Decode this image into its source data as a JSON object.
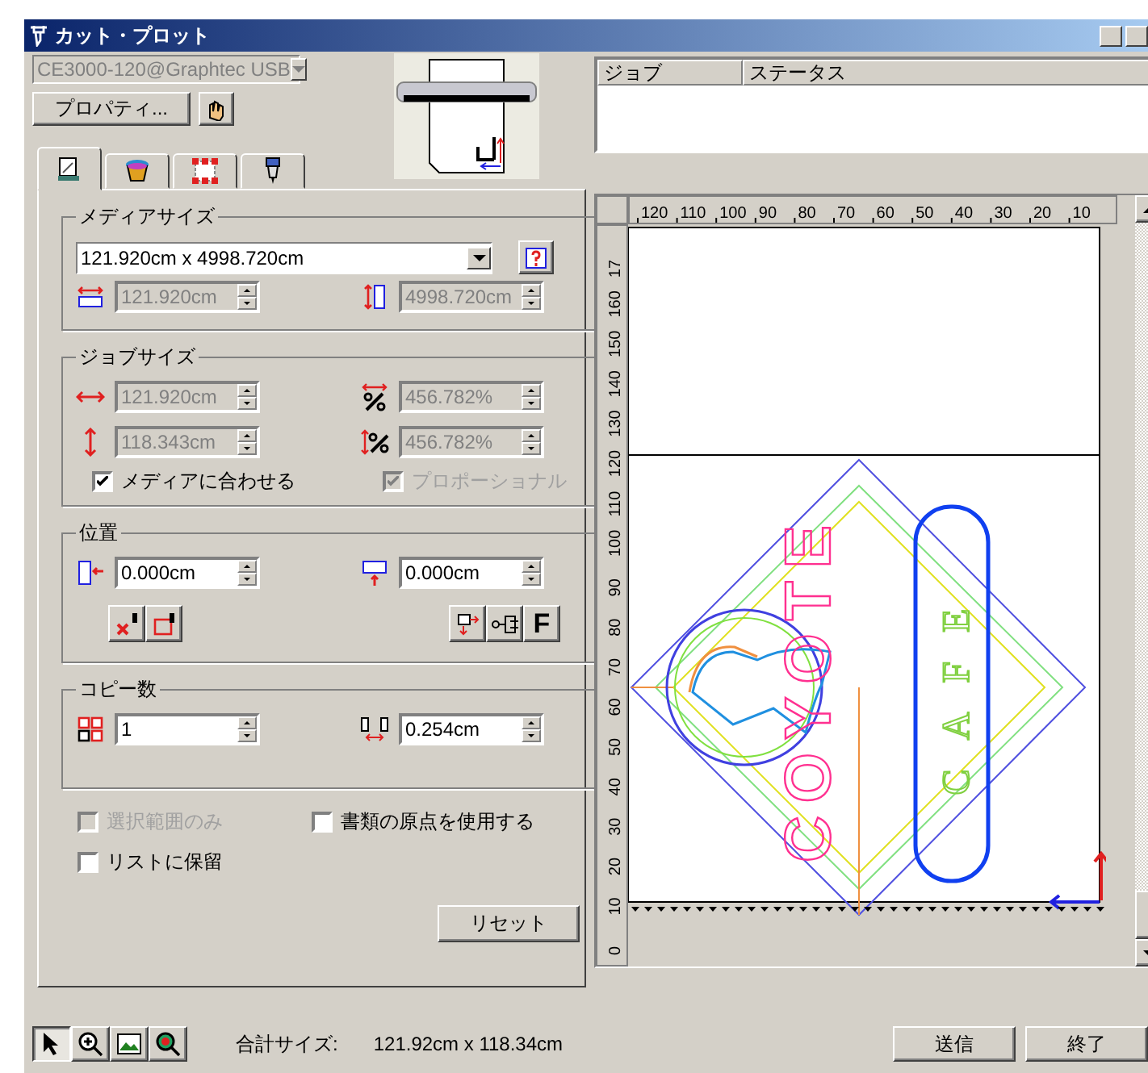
{
  "window": {
    "title": "カット・プロット"
  },
  "printer": {
    "value": "CE3000-120@Graphtec USB",
    "disabled": true
  },
  "properties_button": "プロパティ...",
  "job_list": {
    "columns": [
      "ジョブ",
      "ステータス"
    ]
  },
  "tabs": [
    {
      "selected": true
    },
    {
      "selected": false
    },
    {
      "selected": false
    },
    {
      "selected": false
    }
  ],
  "media_size": {
    "title": "メディアサイズ",
    "value": "121.920cm x 4998.720cm",
    "width": {
      "value": "121.920cm",
      "disabled": true
    },
    "length": {
      "value": "4998.720cm",
      "disabled": true
    }
  },
  "job_size": {
    "title": "ジョブサイズ",
    "width": {
      "value": "121.920cm",
      "disabled": true
    },
    "width_percent": {
      "value": "456.782%",
      "disabled": true
    },
    "height": {
      "value": "118.343cm",
      "disabled": true
    },
    "height_percent": {
      "value": "456.782%",
      "disabled": true
    },
    "checks": [
      {
        "label": "メディアに合わせる",
        "checked": true,
        "disabled": false
      },
      {
        "label": "プロポーショナル",
        "checked": true,
        "disabled": true
      }
    ]
  },
  "position": {
    "title": "位置",
    "x": {
      "value": "0.000cm",
      "disabled": false
    },
    "y": {
      "value": "0.000cm",
      "disabled": false
    },
    "f_button": "F"
  },
  "copies": {
    "title": "コピー数",
    "count": {
      "value": "1",
      "disabled": false
    },
    "spacing": {
      "value": "0.254cm",
      "disabled": false
    }
  },
  "options": [
    {
      "label": "選択範囲のみ",
      "checked": false,
      "disabled": true
    },
    {
      "label": "書類の原点を使用する",
      "checked": false,
      "disabled": false
    },
    {
      "label": "リストに保留",
      "checked": false,
      "disabled": false
    }
  ],
  "reset_button": "リセット",
  "preview": {
    "x_ruler": [
      "120",
      "110",
      "100",
      "90",
      "80",
      "70",
      "60",
      "50",
      "40",
      "30",
      "20",
      "10"
    ],
    "y_ruler": [
      "0",
      "10",
      "20",
      "30",
      "40",
      "50",
      "60",
      "70",
      "80",
      "90",
      "100",
      "110",
      "120",
      "130",
      "140",
      "150",
      "160",
      "17"
    ],
    "design_text": [
      "COYOTE",
      "CAFE"
    ]
  },
  "tools": [
    {
      "selected": true
    },
    {
      "selected": false
    },
    {
      "selected": false
    },
    {
      "selected": false
    }
  ],
  "total_size": {
    "label": "合計サイズ:",
    "value": "121.92cm x 118.34cm"
  },
  "buttons": [
    "送信",
    "終了"
  ]
}
